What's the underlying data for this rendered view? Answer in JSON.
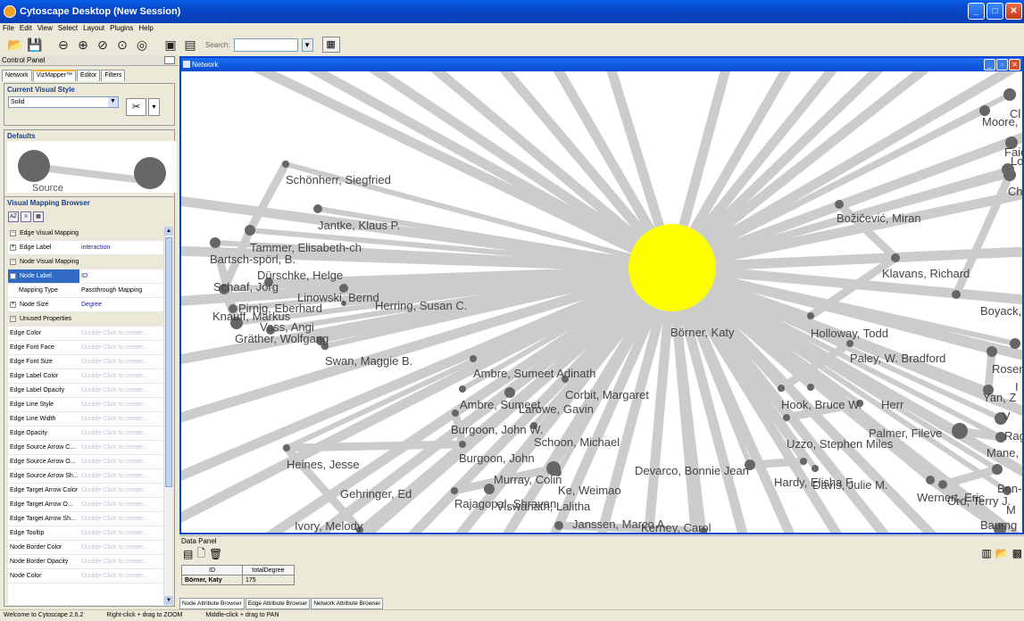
{
  "app": {
    "title": "Cytoscape Desktop (New Session)"
  },
  "menu": [
    "File",
    "Edit",
    "View",
    "Select",
    "Layout",
    "Plugins",
    "Help"
  ],
  "toolbar": {
    "search_label": "Search:",
    "search_value": ""
  },
  "control_panel": {
    "title": "Control Panel",
    "tabs": [
      "Network",
      "VizMapper™",
      "Editor",
      "Filters"
    ],
    "current_visual_style_title": "Current Visual Style",
    "visual_style": "Solid",
    "defaults_title": "Defaults",
    "defaults_label": "Source",
    "vmb_title": "Visual Mapping Browser",
    "properties": [
      {
        "key": "Edge Visual Mapping",
        "type": "cat"
      },
      {
        "key": "Edge Label",
        "value": "interaction",
        "type": "mapped"
      },
      {
        "key": "Node Visual Mapping",
        "type": "cat"
      },
      {
        "key": "Node Label",
        "value": "ID",
        "type": "sel"
      },
      {
        "key": "Mapping Type",
        "value": "Passthrough Mapping",
        "type": "indent"
      },
      {
        "key": "Node Size",
        "value": "Degree",
        "type": "mapped"
      },
      {
        "key": "Unused Properties",
        "type": "cat"
      },
      {
        "key": "Edge Color",
        "value": "Double-Click to create...",
        "type": "unused"
      },
      {
        "key": "Edge Font Face",
        "value": "Double-Click to create...",
        "type": "unused"
      },
      {
        "key": "Edge Font Size",
        "value": "Double-Click to create...",
        "type": "unused"
      },
      {
        "key": "Edge Label Color",
        "value": "Double-Click to create...",
        "type": "unused"
      },
      {
        "key": "Edge Label Opacity",
        "value": "Double-Click to create...",
        "type": "unused"
      },
      {
        "key": "Edge Line Style",
        "value": "Double-Click to create...",
        "type": "unused"
      },
      {
        "key": "Edge Line Width",
        "value": "Double-Click to create...",
        "type": "unused"
      },
      {
        "key": "Edge Opacity",
        "value": "Double-Click to create...",
        "type": "unused"
      },
      {
        "key": "Edge Source Arrow C...",
        "value": "Double-Click to create...",
        "type": "unused"
      },
      {
        "key": "Edge Source Arrow O...",
        "value": "Double-Click to create...",
        "type": "unused"
      },
      {
        "key": "Edge Source Arrow Sh...",
        "value": "Double-Click to create...",
        "type": "unused"
      },
      {
        "key": "Edge Target Arrow Color",
        "value": "Double-Click to create...",
        "type": "unused"
      },
      {
        "key": "Edge Target Arrow O...",
        "value": "Double-Click to create...",
        "type": "unused"
      },
      {
        "key": "Edge Target Arrow Sh...",
        "value": "Double-Click to create...",
        "type": "unused"
      },
      {
        "key": "Edge Tooltip",
        "value": "Double-Click to create...",
        "type": "unused"
      },
      {
        "key": "Node Border Color",
        "value": "Double-Click to create...",
        "type": "unused"
      },
      {
        "key": "Node Border Opacity",
        "value": "Double-Click to create...",
        "type": "unused"
      },
      {
        "key": "Node Color",
        "value": "Double-Click to create...",
        "type": "unused"
      }
    ]
  },
  "network": {
    "title": "Network",
    "center": "Börner, Katy",
    "labels": [
      "Schönherr, Siegfried",
      "Jantke, Klaus P.",
      "Tammer, Elisabeth-ch",
      "Bartsch-spörl, B.",
      "Dürschke, Helge",
      "Schaaf, Jörg",
      "Linowski, Bernd",
      "Pirnig, Eberhard",
      "Herring, Susan C.",
      "Knauff, Markus",
      "Voss, Angi",
      "Gräther, Wolfgang",
      "Swan, Maggie B.",
      "Ambre, Sumeet Adinath",
      "Corbit, Margaret",
      "Ambre, Sumeet",
      "Larowe, Gavin",
      "Burgoon, John W.",
      "Schoon, Michael",
      "Burgoon, John",
      "Heines, Jesse",
      "Murray, Colin",
      "Ke, Weimao",
      "Gehringer, Ed",
      "Rajagopal, Shravan",
      "Viswanath, Lalitha",
      "Janssen, Marco A.",
      "Ivory, Melody",
      "Kerney, Carol",
      "Devarco, Bonnie Jean",
      "Hardy, Elisha F.",
      "Davis, Julie M.",
      "Božičević, Miran",
      "Klavans, Richard",
      "Holloway, Todd",
      "Paley, W. Bradford",
      "Hook, Bruce W.",
      "Herr",
      "Palmer, Fileve",
      "Uzzo, Stephen Miles",
      "Boyack, Kev",
      "Moore,",
      "Ch",
      "Faiola",
      "Lo",
      "Cl",
      "Rosen",
      "Yan, Z",
      "V",
      "Rag",
      "Mane, Keta",
      "Ben-",
      "Wernert, Eric",
      "Ord, Terry J.",
      "M",
      "Baumg",
      "I"
    ]
  },
  "data_panel": {
    "title": "Data Panel",
    "columns": [
      "ID",
      "totalDegree"
    ],
    "rows": [
      [
        "Börner, Katy",
        "175"
      ]
    ],
    "tabs": [
      "Node Attribute Browser",
      "Edge Attribute Browser",
      "Network Attribute Browser"
    ]
  },
  "status": {
    "welcome": "Welcome to Cytoscape 2.6.2",
    "zoom_hint": "Right-click + drag to ZOOM",
    "pan_hint": "Middle-click + drag to PAN"
  },
  "colors": {
    "accent": "#0a5fe8",
    "center_node": "#ffff00",
    "node": "#666666",
    "edge": "#cccccc"
  }
}
